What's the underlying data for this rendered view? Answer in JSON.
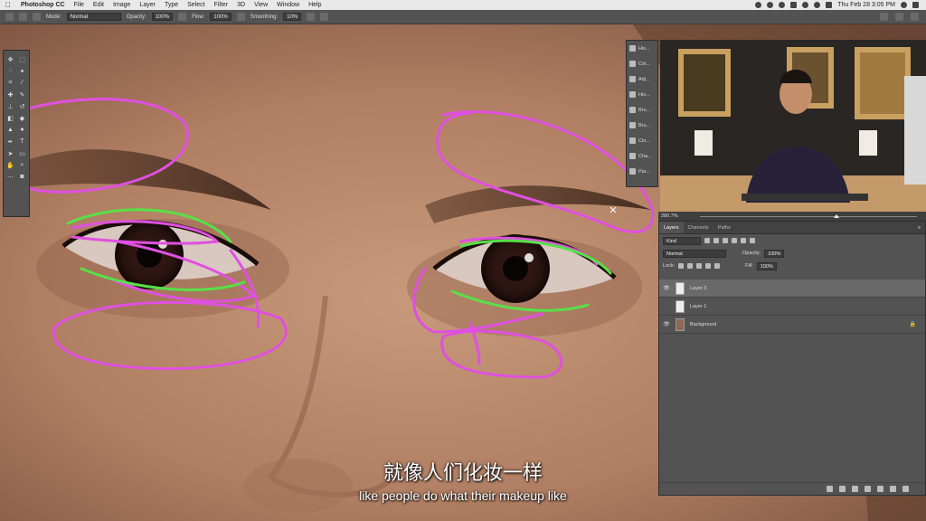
{
  "menubar": {
    "apple": "",
    "app_name": "Photoshop CC",
    "items": [
      "File",
      "Edit",
      "Image",
      "Layer",
      "Type",
      "Select",
      "Filter",
      "3D",
      "View",
      "Window",
      "Help"
    ],
    "datetime": "Thu Feb 28  3:05 PM"
  },
  "options_bar": {
    "mode_label": "Mode:",
    "mode_value": "Normal",
    "opacity_label": "Opacity:",
    "opacity_value": "100%",
    "flow_label": "Flow:",
    "flow_value": "100%",
    "smoothing_label": "Smoothing:",
    "smoothing_value": "10%"
  },
  "colors": {
    "foreground": "#55d645",
    "background": "#000000",
    "annotation_pink": "#e050e0",
    "annotation_green": "#58e048"
  },
  "side_strip": {
    "items": [
      "His...",
      "Col...",
      "Adj...",
      "His...",
      "Bru...",
      "Bru...",
      "Clo...",
      "Cha...",
      "Par..."
    ]
  },
  "zoom": {
    "value": "280.7%"
  },
  "layers_panel": {
    "tabs": [
      "Layers",
      "Channels",
      "Paths"
    ],
    "filter_label": "Kind",
    "blend_mode": "Normal",
    "opacity_label": "Opacity:",
    "opacity_value": "100%",
    "lock_label": "Lock:",
    "fill_label": "Fill:",
    "fill_value": "100%",
    "layers": [
      {
        "name": "Layer 3",
        "visible": true,
        "active": true
      },
      {
        "name": "Layer 1",
        "visible": false,
        "active": false
      },
      {
        "name": "Background",
        "visible": true,
        "active": false,
        "locked": true
      }
    ]
  },
  "subtitles": {
    "chinese": "就像人们化妆一样",
    "english": "like people do what their makeup like"
  }
}
